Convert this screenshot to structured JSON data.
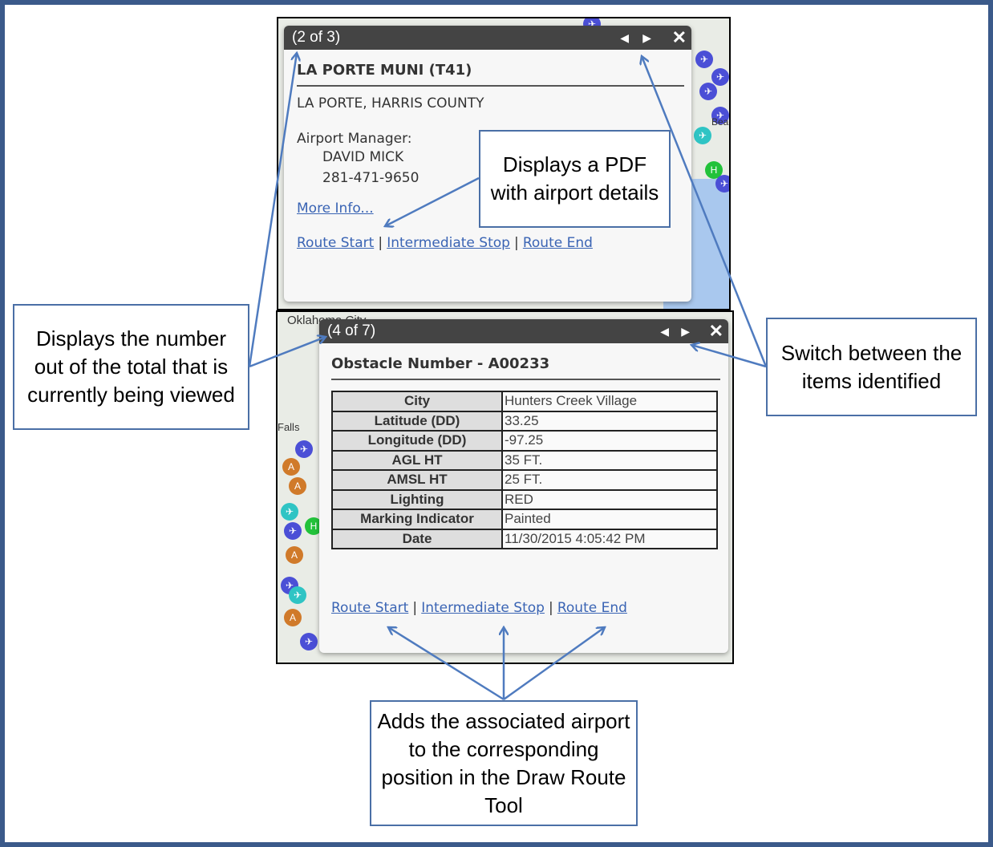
{
  "popup_airport": {
    "counter": "(2 of 3)",
    "title": "LA PORTE MUNI (T41)",
    "location": "LA PORTE, HARRIS COUNTY",
    "manager_label": "Airport Manager:",
    "manager_name": "DAVID MICK",
    "manager_phone": "281-471-9650",
    "more_info": "More Info...",
    "links": [
      "Route Start",
      "Intermediate Stop",
      "Route End"
    ],
    "separator": "|"
  },
  "popup_obstacle": {
    "counter": "(4 of 7)",
    "title": "Obstacle Number - A00233",
    "rows": [
      {
        "key": "City",
        "value": "Hunters Creek Village"
      },
      {
        "key": "Latitude (DD)",
        "value": "33.25"
      },
      {
        "key": "Longitude (DD)",
        "value": "-97.25"
      },
      {
        "key": "AGL HT",
        "value": "35 FT."
      },
      {
        "key": "AMSL HT",
        "value": "25 FT."
      },
      {
        "key": "Lighting",
        "value": "RED"
      },
      {
        "key": "Marking Indicator",
        "value": "Painted"
      },
      {
        "key": "Date",
        "value": "11/30/2015 4:05:42 PM"
      }
    ],
    "links": [
      "Route Start",
      "Intermediate Stop",
      "Route End"
    ],
    "separator": "|"
  },
  "map_labels": {
    "top_right": "Bea",
    "city": "Oklahoma City",
    "falls": "Falls"
  },
  "icons": {
    "prev": "◀",
    "next": "▶",
    "close": "✕",
    "airport": "✈",
    "heliport": "H",
    "obstacle": "A"
  },
  "callouts": {
    "counter": "Displays the number out of the total that is currently being viewed",
    "pdf": "Displays a PDF with airport details",
    "switch": "Switch between the items identified",
    "route": "Adds the associated airport to the corresponding position in the Draw Route Tool"
  },
  "colors": {
    "frame": "#3b5a8a",
    "callout_border": "#4a6fa6",
    "arrow": "#4f7bbf",
    "link": "#3a64b4",
    "header": "#444444"
  }
}
